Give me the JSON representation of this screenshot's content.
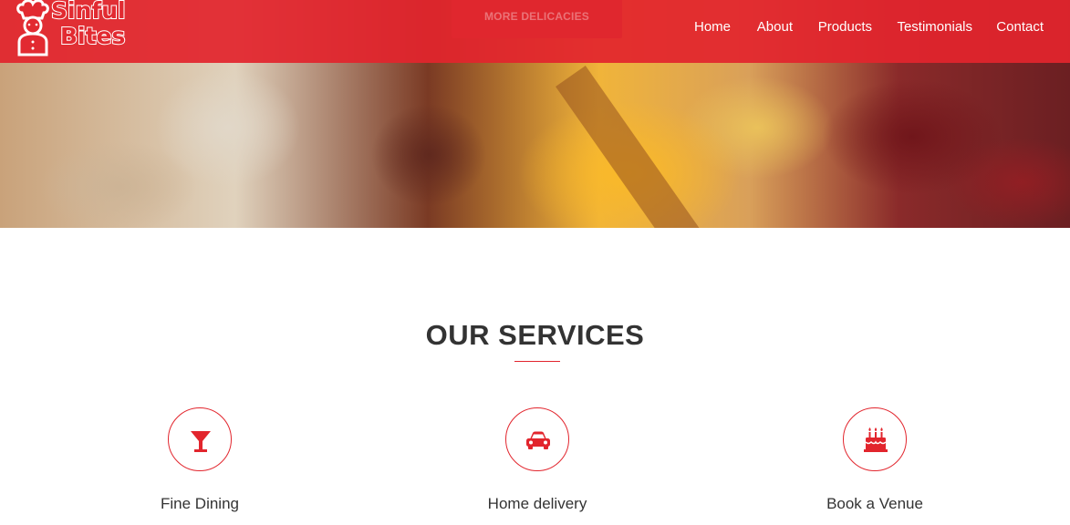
{
  "brand": {
    "line1": "Sinful",
    "line2": "Bites",
    "color": "#e2252d"
  },
  "header": {
    "cta_label": "MORE DELICACIES",
    "nav": [
      {
        "label": "Home"
      },
      {
        "label": "About"
      },
      {
        "label": "Products"
      },
      {
        "label": "Testimonials"
      },
      {
        "label": "Contact"
      }
    ]
  },
  "services": {
    "title": "OUR SERVICES",
    "items": [
      {
        "label": "Fine Dining",
        "icon": "cocktail-icon"
      },
      {
        "label": "Home delivery",
        "icon": "car-icon"
      },
      {
        "label": "Book a Venue",
        "icon": "birthday-cake-icon"
      }
    ]
  }
}
